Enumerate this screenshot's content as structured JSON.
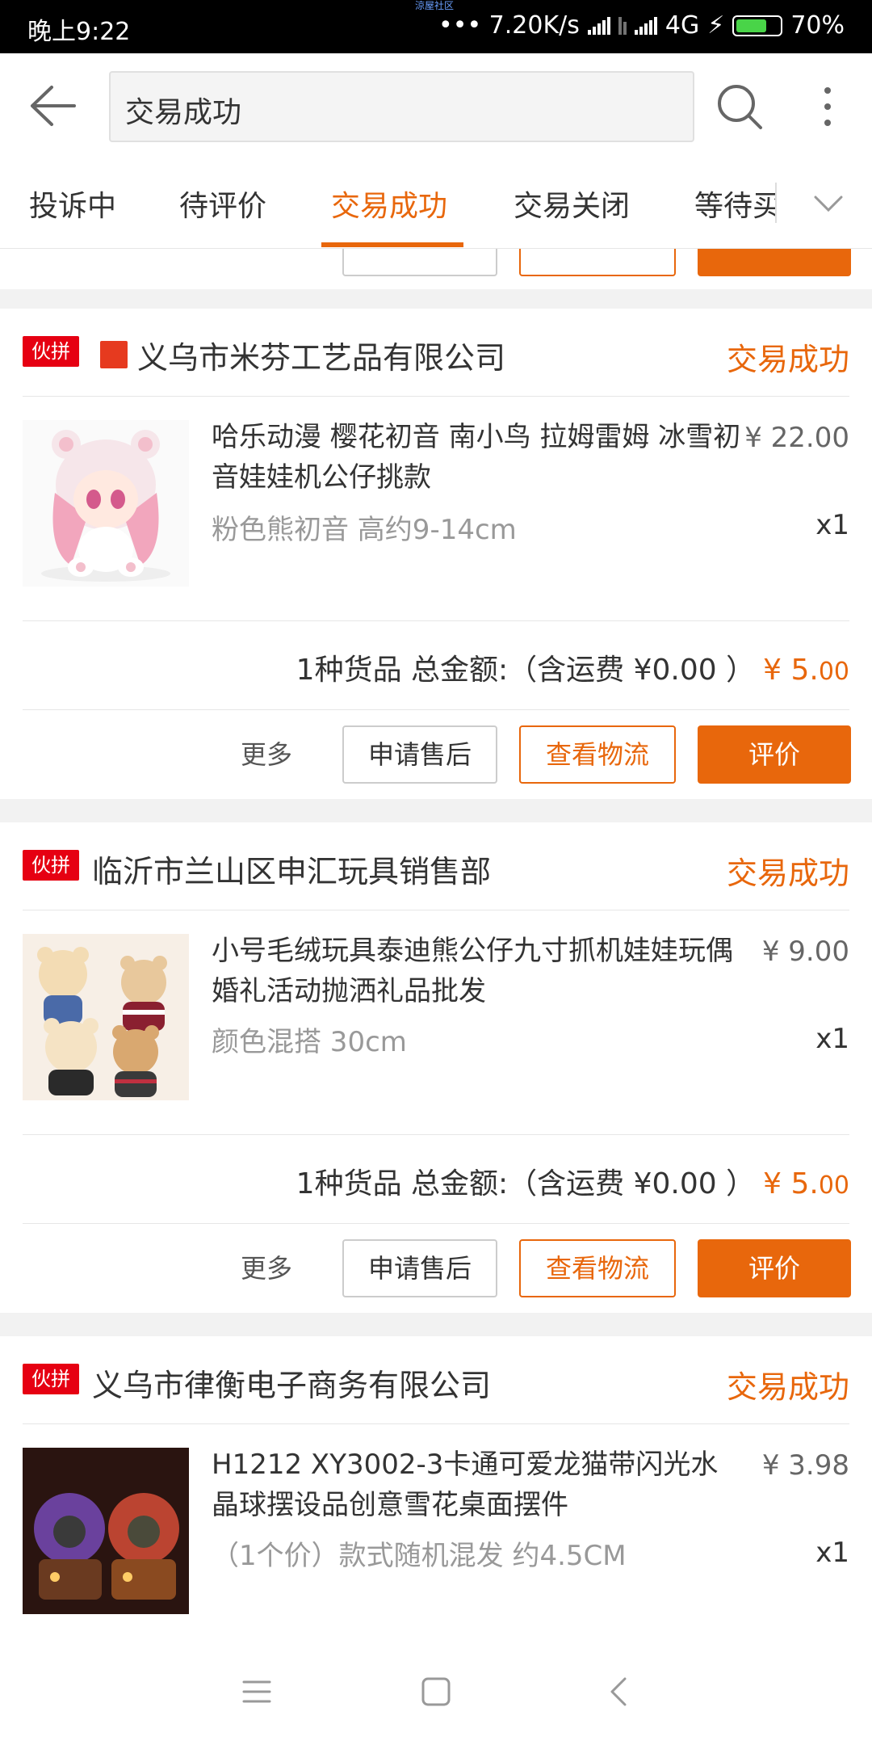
{
  "status_bar": {
    "time": "晚上9:22",
    "tiny_label": "涼屋社区",
    "network_speed": "••• 7.20K/s",
    "network_type": "4G",
    "battery": "70%",
    "battery_level": 0.7
  },
  "header": {
    "search_value": "交易成功"
  },
  "tabs": [
    "投诉中",
    "待评价",
    "交易成功",
    "交易关闭",
    "等待买"
  ],
  "active_tab": 2,
  "orders": [
    {
      "tag": "伙拼",
      "store": "义乌市米芬工艺品有限公司",
      "status": "交易成功",
      "title": "哈乐动漫 樱花初音 南小鸟 拉姆雷姆 冰雪初音娃娃机公仔挑款",
      "price": "¥ 22.00",
      "spec": "粉色熊初音 高约9-14cm",
      "qty": "x1",
      "summary": "1种货品 总金额:（含运费 ¥0.00 ）",
      "total_main": "¥ 5.",
      "total_cents": "00",
      "more": "更多",
      "after_sale": "申请售后",
      "logistics": "查看物流",
      "review": "评价"
    },
    {
      "tag": "伙拼",
      "store": "临沂市兰山区申汇玩具销售部",
      "status": "交易成功",
      "title": "小号毛绒玩具泰迪熊公仔九寸抓机娃娃玩偶婚礼活动抛洒礼品批发",
      "price": "¥ 9.00",
      "spec": "颜色混搭 30cm",
      "qty": "x1",
      "summary": "1种货品 总金额:（含运费 ¥0.00 ）",
      "total_main": "¥ 5.",
      "total_cents": "00",
      "more": "更多",
      "after_sale": "申请售后",
      "logistics": "查看物流",
      "review": "评价"
    },
    {
      "tag": "伙拼",
      "store": "义乌市律衡电子商务有限公司",
      "status": "交易成功",
      "title": "H1212 XY3002-3卡通可爱龙猫带闪光水晶球摆设品创意雪花桌面摆件",
      "price": "¥ 3.98",
      "spec": "（1个价）款式随机混发 约4.5CM",
      "qty": "x1"
    }
  ],
  "colors": {
    "accent": "#e8670c",
    "tag_red": "#e60012"
  }
}
